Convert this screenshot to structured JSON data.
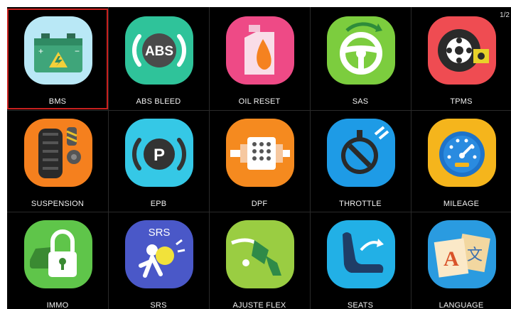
{
  "page_indicator": "1/2",
  "tiles": [
    {
      "label": "BMS",
      "icon": "battery-icon",
      "selected": true
    },
    {
      "label": "ABS BLEED",
      "icon": "abs-icon"
    },
    {
      "label": "OIL RESET",
      "icon": "oil-can-icon"
    },
    {
      "label": "SAS",
      "icon": "steering-wheel-icon"
    },
    {
      "label": "TPMS",
      "icon": "tire-sensor-icon"
    },
    {
      "label": "SUSPENSION",
      "icon": "suspension-icon"
    },
    {
      "label": "EPB",
      "icon": "parking-brake-icon"
    },
    {
      "label": "DPF",
      "icon": "particulate-filter-icon"
    },
    {
      "label": "THROTTLE",
      "icon": "throttle-icon"
    },
    {
      "label": "MILEAGE",
      "icon": "speedometer-icon"
    },
    {
      "label": "IMMO",
      "icon": "immobilizer-lock-icon"
    },
    {
      "label": "SRS",
      "icon": "airbag-icon",
      "icon_text": "SRS"
    },
    {
      "label": "AJUSTE FLEX",
      "icon": "fuel-nozzle-icon"
    },
    {
      "label": "SEATS",
      "icon": "seat-icon"
    },
    {
      "label": "LANGUAGE",
      "icon": "language-icon",
      "icon_text": "A"
    }
  ]
}
